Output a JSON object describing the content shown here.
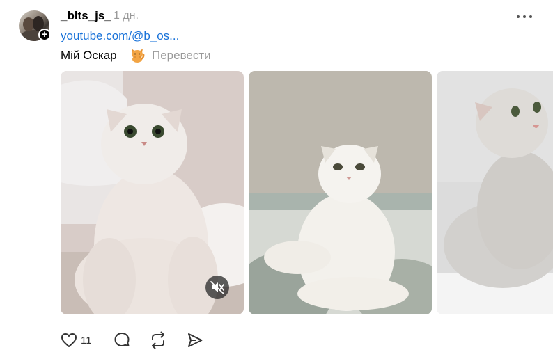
{
  "post": {
    "username": "_blts_js_",
    "timestamp": "1 дн.",
    "link_text": "youtube.com/@b_os...",
    "caption": "Мій Оскар",
    "caption_emoji": "cat-emoji",
    "translate_label": "Перевести"
  },
  "media": {
    "items": [
      "cat-photo-1",
      "cat-photo-2",
      "cat-photo-3"
    ],
    "video_muted": true
  },
  "actions": {
    "like_count": "11",
    "icons": [
      "heart-icon",
      "comment-icon",
      "repost-icon",
      "share-icon"
    ]
  },
  "colors": {
    "link": "#1a73d9",
    "muted_text": "#999999",
    "icon": "#333333"
  }
}
